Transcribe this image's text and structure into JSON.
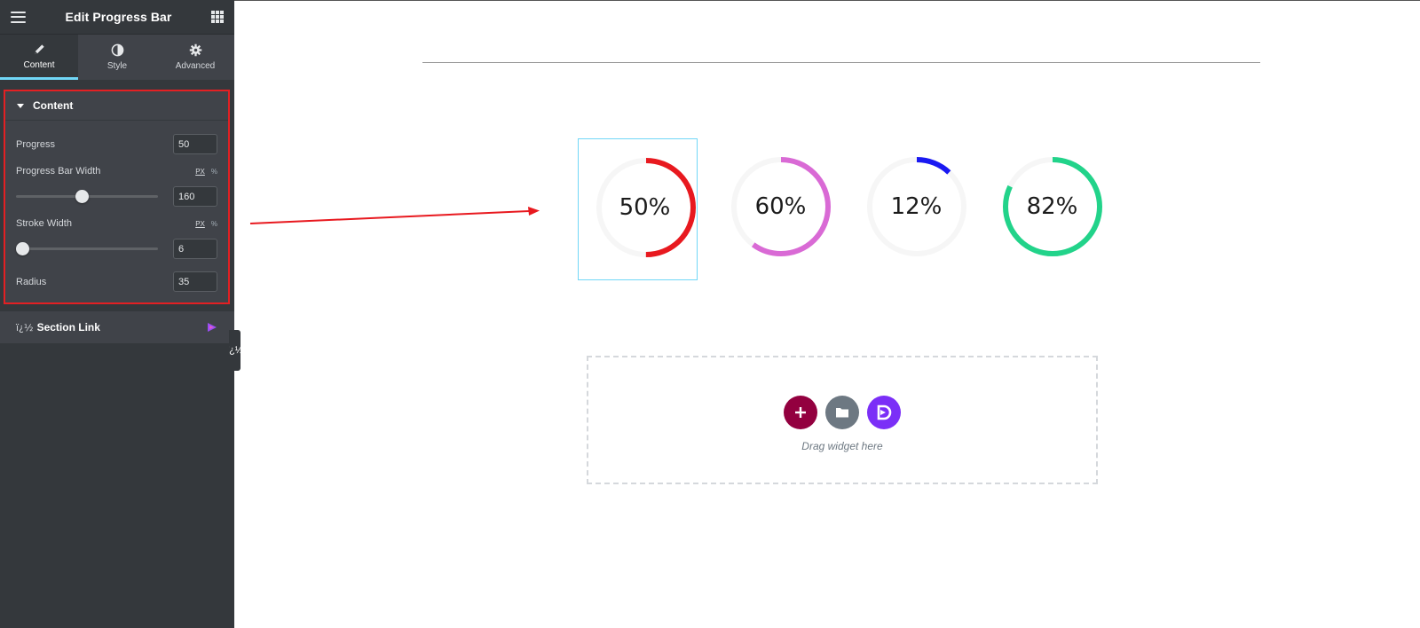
{
  "panel": {
    "title": "Edit Progress Bar",
    "tabs": [
      {
        "label": "Content",
        "icon": "pencil-icon",
        "active": true
      },
      {
        "label": "Style",
        "icon": "half-circle-icon",
        "active": false
      },
      {
        "label": "Advanced",
        "icon": "gear-icon",
        "active": false
      }
    ],
    "section": {
      "title": "Content",
      "progress_label": "Progress",
      "progress_value": "50",
      "width_label": "Progress Bar Width",
      "width_value": "160",
      "width_slider_level": 0.46,
      "stroke_label": "Stroke Width",
      "stroke_value": "6",
      "stroke_slider_level": 0.0,
      "radius_label": "Radius",
      "radius_value": "35",
      "units": [
        "PX",
        "%"
      ]
    },
    "section_link": {
      "glyph": "ï¿½",
      "label": "Section Link"
    },
    "handle_glyph": "ï¿½"
  },
  "canvas": {
    "widgets": [
      {
        "text": "50%",
        "percent": 50,
        "color": "#e8191f",
        "selected": true
      },
      {
        "text": "60%",
        "percent": 60,
        "color": "#d96ad5",
        "selected": false
      },
      {
        "text": "12%",
        "percent": 12,
        "color": "#1a19f2",
        "selected": false
      },
      {
        "text": "82%",
        "percent": 82,
        "color": "#22d38a",
        "selected": false
      }
    ],
    "drop_zone": {
      "hint": "Drag widget here"
    }
  },
  "colors": {
    "accent_tab": "#71d7f7",
    "highlight_box": "#e32023",
    "add_button": "#93003f",
    "folder_button": "#6d7882",
    "brand_button": "#7b2ff7"
  }
}
